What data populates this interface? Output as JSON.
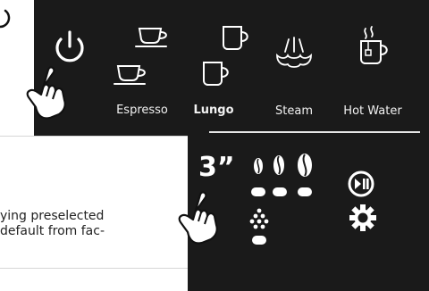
{
  "labels": {
    "espresso": "Espresso",
    "lungo": "Lungo",
    "steam": "Steam",
    "hot_water": "Hot Water"
  },
  "display": {
    "time_value": "3”"
  },
  "instructions": {
    "line1": "ying preselected",
    "line2": "default from fac-"
  },
  "icons": {
    "power": "power-icon",
    "cup_small": "espresso-cup-icon",
    "mug": "lungo-mug-icon",
    "steam": "steam-icon",
    "hot_water": "hot-water-mug-icon",
    "bean": "coffee-bean-icon",
    "play_pause": "play-pause-icon",
    "gear": "gear-icon",
    "hand": "pointing-hand-icon"
  },
  "colors": {
    "panel": "#1a1a1a",
    "foreground": "#ffffff"
  }
}
